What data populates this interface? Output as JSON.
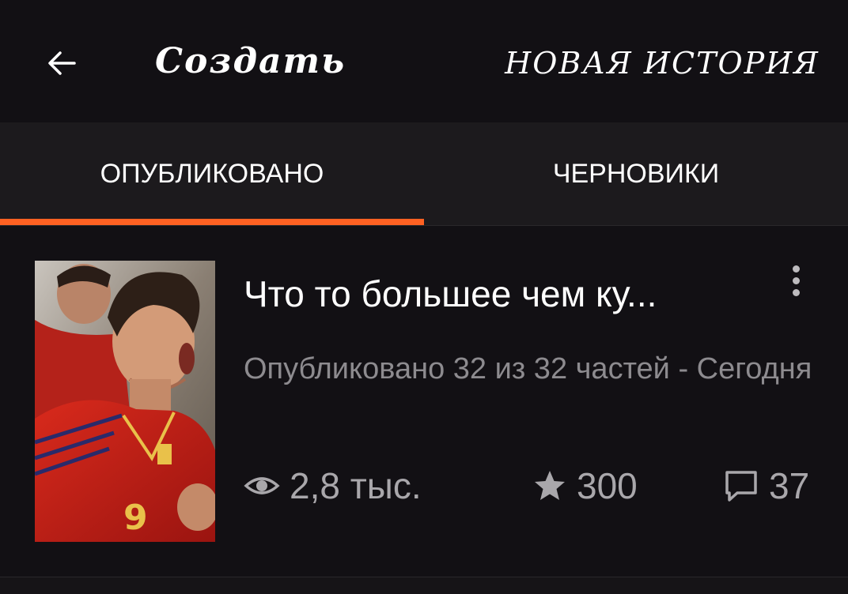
{
  "header": {
    "title": "Создать",
    "new_story_label": "НОВАЯ ИСТОРИЯ"
  },
  "tabs": [
    {
      "label": "ОПУБЛИКОВАНО",
      "active": true
    },
    {
      "label": "ЧЕРНОВИКИ",
      "active": false
    }
  ],
  "story": {
    "title": "Что то большее чем ку...",
    "meta": "Опубликовано 32 из 32 частей - Сегодня",
    "reads": "2,8 тыс.",
    "votes": "300",
    "comments": "37"
  },
  "colors": {
    "accent": "#ff6122",
    "background": "#121014",
    "tab_bar": "#1c1a1d"
  },
  "icons": {
    "back": "arrow-left-icon",
    "more": "kebab-menu-icon",
    "reads": "eye-icon",
    "votes": "star-icon",
    "comments": "comment-icon"
  }
}
